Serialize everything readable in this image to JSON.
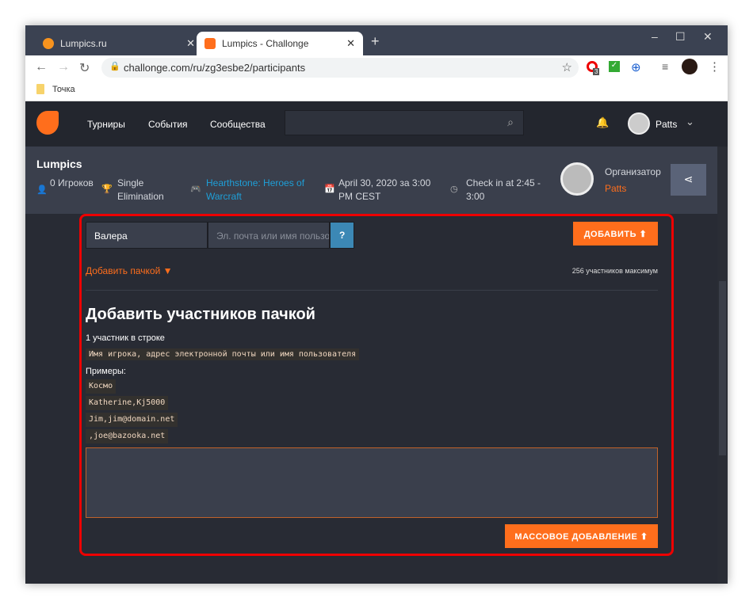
{
  "browser": {
    "tabs": [
      {
        "title": "Lumpics.ru",
        "active": false
      },
      {
        "title": "Lumpics - Challonge",
        "active": true
      }
    ],
    "url": "challonge.com/ru/zg3esbe2/participants",
    "bookmark": "Точка",
    "ext_badge": "3"
  },
  "nav": {
    "items": [
      "Турниры",
      "События",
      "Сообщества"
    ],
    "user": "Patts"
  },
  "tournament": {
    "name": "Lumpics",
    "players": "0 Игроков",
    "format": "Single Elimination",
    "game": "Hearthstone: Heroes of Warcraft",
    "date": "April 30, 2020 за 3:00 PM CEST",
    "checkin": "Check in at 2:45 - 3:00",
    "organizer_label": "Организатор",
    "organizer": "Patts"
  },
  "form": {
    "name_value": "Валера",
    "email_placeholder": "Эл. почта или имя пользователя",
    "help": "?",
    "add": "ДОБАВИТЬ ⬆",
    "bulk_toggle": "Добавить пачкой ▼",
    "max": "256 участников максимум",
    "bulk_title": "Добавить участников пачкой",
    "per_line": "1 участник в строке",
    "format": "Имя игрока, адрес электронной почты или имя пользователя",
    "examples_label": "Примеры:",
    "examples": [
      "Космо",
      "Katherine,Kj5000",
      "Jim,jim@domain.net",
      ",joe@bazooka.net"
    ],
    "bulk_add": "МАССОВОЕ ДОБАВЛЕНИЕ ⬆"
  },
  "colors": {
    "accent": "#ff6e1c",
    "link": "#1e9fd8",
    "highlight": "#ee0000"
  }
}
